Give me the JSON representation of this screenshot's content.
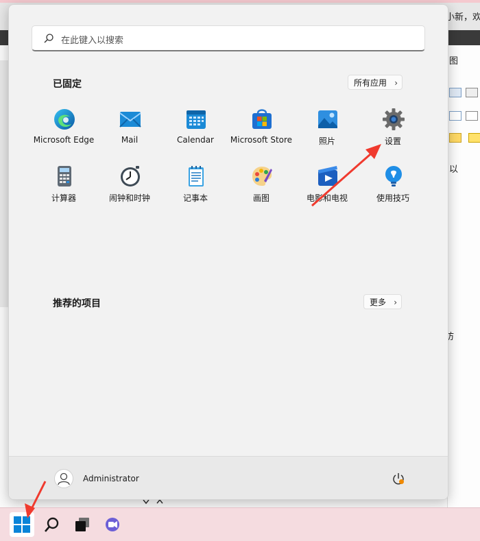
{
  "background": {
    "title_fragment": "小新，欢",
    "right_panel_texts": [
      "图",
      "以",
      "访"
    ]
  },
  "search": {
    "placeholder": "在此键入以搜索"
  },
  "pinned": {
    "title": "已固定",
    "all_apps_label": "所有应用",
    "apps": [
      {
        "name": "Microsoft Edge",
        "icon": "edge-icon"
      },
      {
        "name": "Mail",
        "icon": "mail-icon"
      },
      {
        "name": "Calendar",
        "icon": "calendar-icon"
      },
      {
        "name": "Microsoft Store",
        "icon": "store-icon"
      },
      {
        "name": "照片",
        "icon": "photos-icon"
      },
      {
        "name": "设置",
        "icon": "gear-icon"
      },
      {
        "name": "计算器",
        "icon": "calculator-icon"
      },
      {
        "name": "闹钟和时钟",
        "icon": "clock-icon"
      },
      {
        "name": "记事本",
        "icon": "notepad-icon"
      },
      {
        "name": "画图",
        "icon": "paint-icon"
      },
      {
        "name": "电影和电视",
        "icon": "movies-icon"
      },
      {
        "name": "使用技巧",
        "icon": "tips-icon"
      }
    ]
  },
  "recommended": {
    "title": "推荐的项目",
    "more_label": "更多"
  },
  "user": {
    "name": "Administrator"
  },
  "colors": {
    "accent": "#0078d4",
    "annotation_arrow": "#f03a2e"
  }
}
